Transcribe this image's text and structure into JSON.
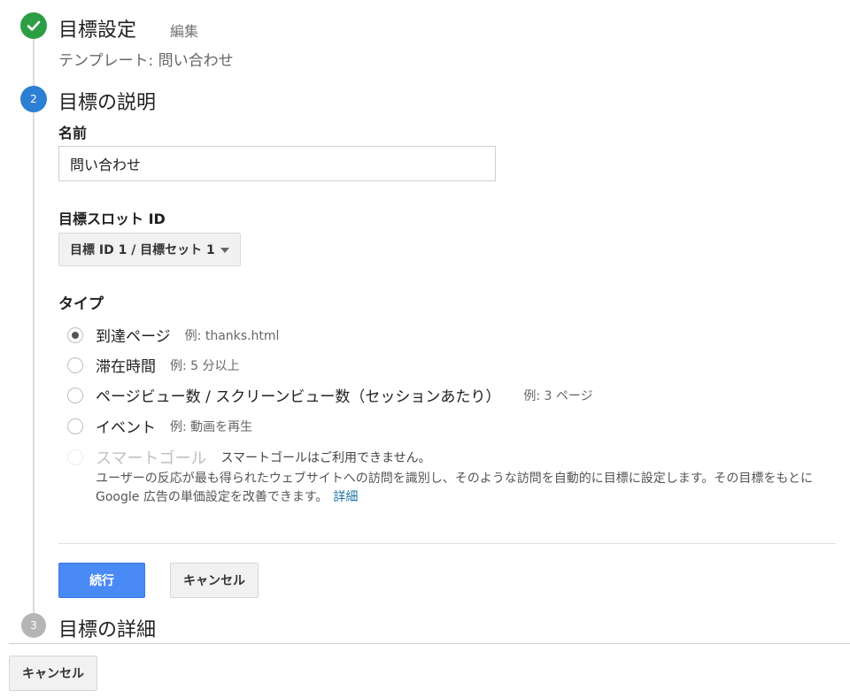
{
  "steps": {
    "step1": {
      "title": "目標設定",
      "edit_label": "編集",
      "template_text": "テンプレート: 問い合わせ"
    },
    "step2": {
      "number": "2",
      "title": "目標の説明"
    },
    "step3": {
      "number": "3",
      "title": "目標の詳細"
    }
  },
  "form": {
    "name_label": "名前",
    "name_value": "問い合わせ",
    "slot_label": "目標スロット ID",
    "slot_value": "目標 ID 1 / 目標セット 1",
    "type_label": "タイプ",
    "types": [
      {
        "label": "到達ページ",
        "example": "例: thanks.html",
        "checked": true
      },
      {
        "label": "滞在時間",
        "example": "例: 5 分以上"
      },
      {
        "label": "ページビュー数 / スクリーンビュー数（セッションあたり）",
        "example": "例: 3 ページ"
      },
      {
        "label": "イベント",
        "example": "例: 動画を再生"
      },
      {
        "label": "スマートゴール",
        "example": "スマートゴールはご利用できません。",
        "disabled": true
      }
    ],
    "smart_description": "ユーザーの反応が最も得られたウェブサイトへの訪問を識別し、そのような訪問を自動的に目標に設定します。その目標をもとに Google 広告の単価設定を改善できます。",
    "details_link": "詳細"
  },
  "buttons": {
    "continue": "続行",
    "cancel_inline": "キャンセル",
    "cancel_bottom": "キャンセル"
  },
  "colors": {
    "primary": "#4a8af4",
    "step_done": "#2e9e44",
    "step_active": "#2d7fd3",
    "step_pending": "#b5b5b5"
  }
}
